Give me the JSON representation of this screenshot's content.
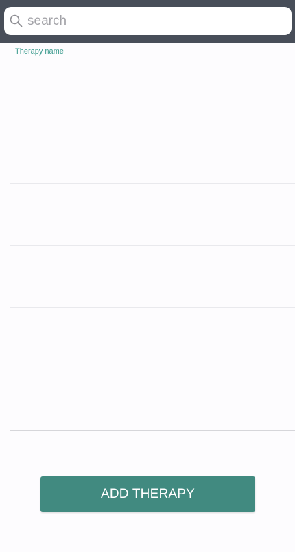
{
  "search": {
    "placeholder": "search",
    "icon": "search-icon"
  },
  "table": {
    "column_header": "Therapy name",
    "rows": [
      "",
      "",
      "",
      "",
      "",
      ""
    ]
  },
  "actions": {
    "add_therapy_label": "ADD THERAPY"
  },
  "colors": {
    "search_bar_bg": "#484e59",
    "accent": "#3a9a8d",
    "button_bg": "#418a80",
    "page_bg": "#fdfcfe"
  }
}
